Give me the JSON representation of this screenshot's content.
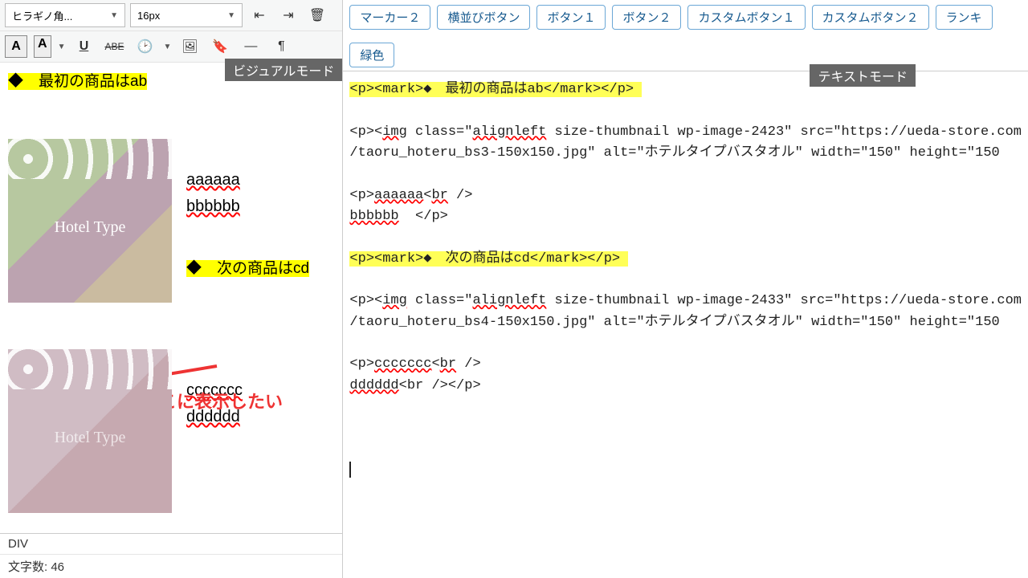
{
  "toolbar": {
    "font_family": "ヒラギノ角...",
    "font_size": "16px",
    "visual_label": "ビジュアルモード",
    "text_label": "テキストモード",
    "a_boxed": "A",
    "a_colored": "A",
    "underline": "U",
    "strike": "ABE",
    "clock": "⏰"
  },
  "buttons": {
    "marker2": "マーカー２",
    "horiz_btn": "横並びボタン",
    "btn1": "ボタン１",
    "btn2": "ボタン２",
    "custom1": "カスタムボタン１",
    "custom2": "カスタムボタン２",
    "rank": "ランキ",
    "green": "緑色"
  },
  "visual": {
    "first_product": "◆　最初の商品はab",
    "aaaa": "aaaaaa",
    "bbbb": "bbbbbb",
    "next_product": "◆　次の商品はcd",
    "cccc": "ccccccc",
    "dddd": "dddddd",
    "hotel": "Hotel Type",
    "annotation": "本来はここに表示したい"
  },
  "footer": {
    "path": "DIV",
    "chars_label": "文字数: ",
    "chars_count": "46"
  },
  "text": {
    "l1": "<p><mark>◆　最初の商品はab</mark></p>",
    "l2a": "<p><",
    "l2_img": "img",
    "l2b": " class=\"",
    "l2_al": "alignleft",
    "l2c": " size-thumbnail wp-image-2423\" src=\"https://ueda-store.com",
    "l3": "/taoru_hoteru_bs3-150x150.jpg\" alt=\"ホテルタイプバスタオル\" width=\"150\" height=\"150",
    "l4a": "<p>",
    "l4_aa": "aaaaaa",
    "l4b": "<",
    "l4_br": "br",
    "l4c": " />",
    "l5_bb": "bbbbbb",
    "l5b": "  </p>",
    "l6": "<p><mark>◆　次の商品はcd</mark></p>",
    "l7a": "<p><",
    "l7_img": "img",
    "l7b": " class=\"",
    "l7_al": "alignleft",
    "l7c": " size-thumbnail wp-image-2433\" src=\"https://ueda-store.com",
    "l8": "/taoru_hoteru_bs4-150x150.jpg\" alt=\"ホテルタイプバスタオル\" width=\"150\" height=\"150",
    "l9a": "<p>",
    "l9_cc": "ccccccc",
    "l9b": "<",
    "l9_br": "br",
    "l9c": " />",
    "l10_dd": "dddddd",
    "l10b": "<br /></p>"
  }
}
